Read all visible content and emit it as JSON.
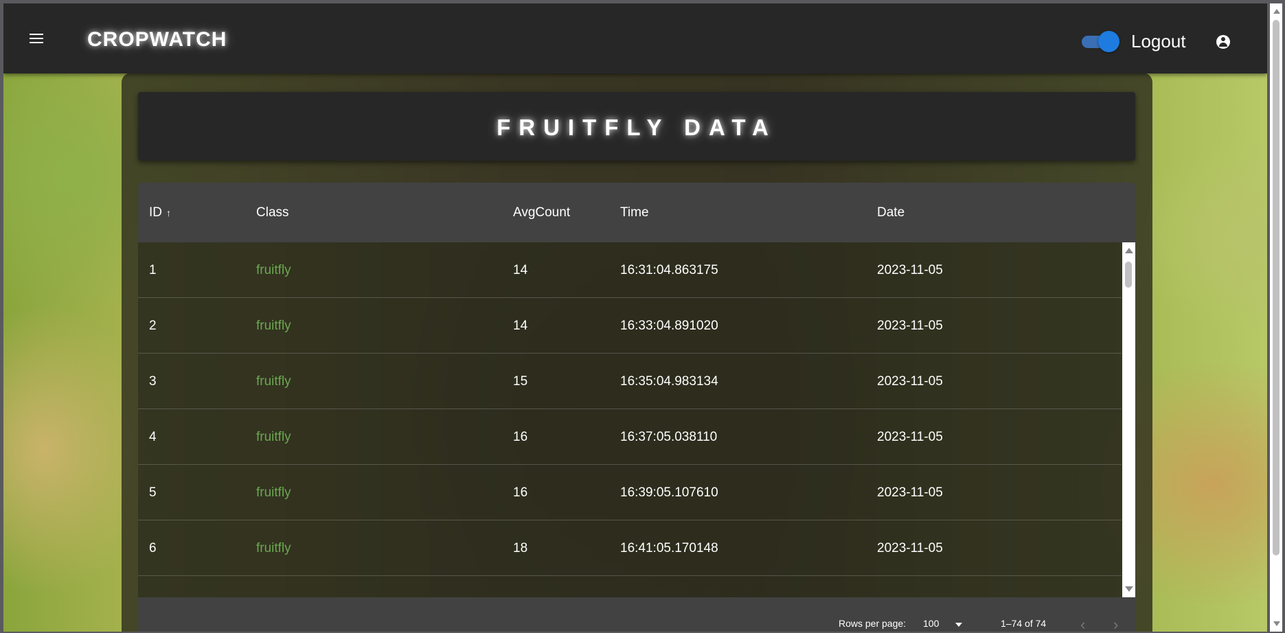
{
  "app": {
    "brand": "CROPWATCH",
    "logout_label": "Logout",
    "theme_toggle_on": true
  },
  "page": {
    "title": "FRUITFLY DATA"
  },
  "table": {
    "columns": [
      "ID",
      "Class",
      "AvgCount",
      "Time",
      "Date"
    ],
    "sort_indicator": "↑",
    "rows": [
      {
        "id": "1",
        "class": "fruitfly",
        "avgcount": "14",
        "time": "16:31:04.863175",
        "date": "2023-11-05"
      },
      {
        "id": "2",
        "class": "fruitfly",
        "avgcount": "14",
        "time": "16:33:04.891020",
        "date": "2023-11-05"
      },
      {
        "id": "3",
        "class": "fruitfly",
        "avgcount": "15",
        "time": "16:35:04.983134",
        "date": "2023-11-05"
      },
      {
        "id": "4",
        "class": "fruitfly",
        "avgcount": "16",
        "time": "16:37:05.038110",
        "date": "2023-11-05"
      },
      {
        "id": "5",
        "class": "fruitfly",
        "avgcount": "16",
        "time": "16:39:05.107610",
        "date": "2023-11-05"
      },
      {
        "id": "6",
        "class": "fruitfly",
        "avgcount": "18",
        "time": "16:41:05.170148",
        "date": "2023-11-05"
      }
    ],
    "footer": {
      "rows_per_page_label": "Rows per page:",
      "rows_per_page_value": "100",
      "range_text": "1–74 of 74",
      "prev_glyph": "‹",
      "next_glyph": "›"
    }
  }
}
